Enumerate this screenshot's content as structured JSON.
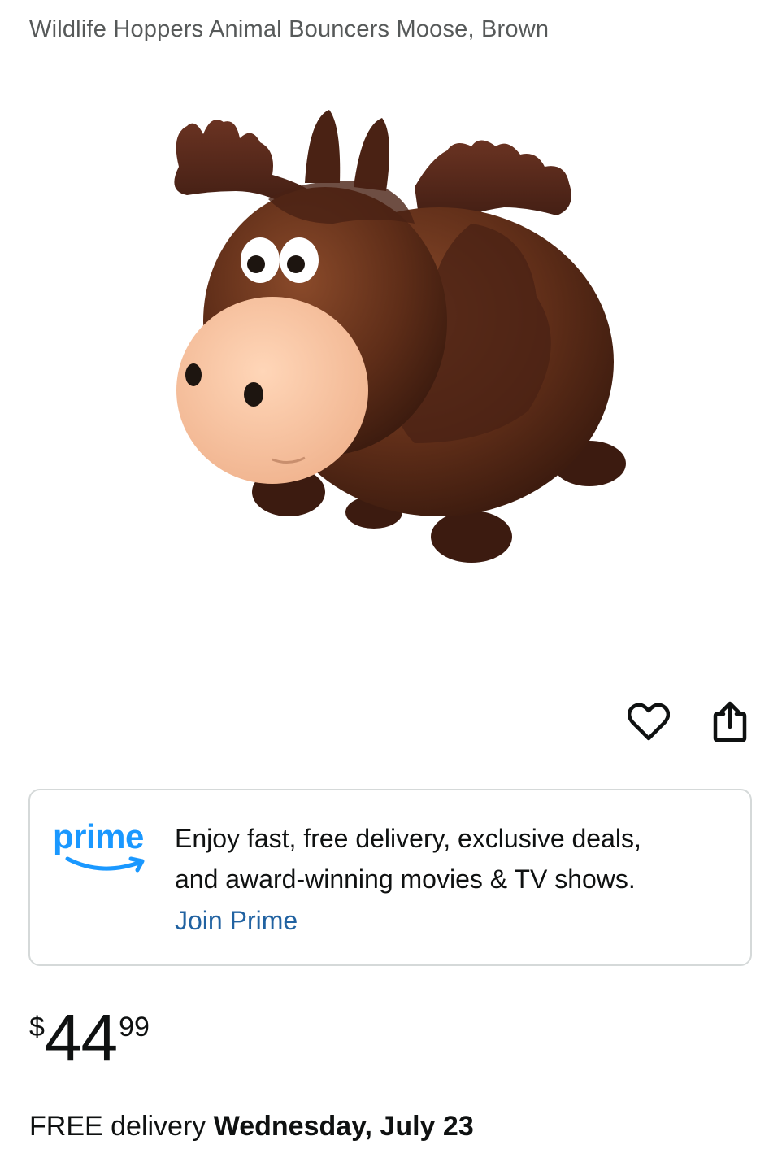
{
  "product": {
    "title": "Wildlife Hoppers Animal Bouncers Moose, Brown",
    "image_alt": "Brown inflatable moose hopper toy"
  },
  "actions": {
    "wishlist_icon": "heart-icon",
    "share_icon": "share-icon"
  },
  "prime_banner": {
    "logo_text": "prime",
    "message_line1": "Enjoy fast, free delivery, exclusive deals,",
    "message_line2": "and award-winning movies & TV shows.",
    "join_label": "Join Prime"
  },
  "price": {
    "symbol": "$",
    "whole": "44",
    "fraction": "99"
  },
  "delivery": {
    "prefix": "FREE delivery",
    "date": "Wednesday, July 23"
  },
  "colors": {
    "prime_blue": "#1a98ff",
    "link_blue": "#2162a1",
    "title_gray": "#565959",
    "card_border": "#d5d9d9"
  }
}
